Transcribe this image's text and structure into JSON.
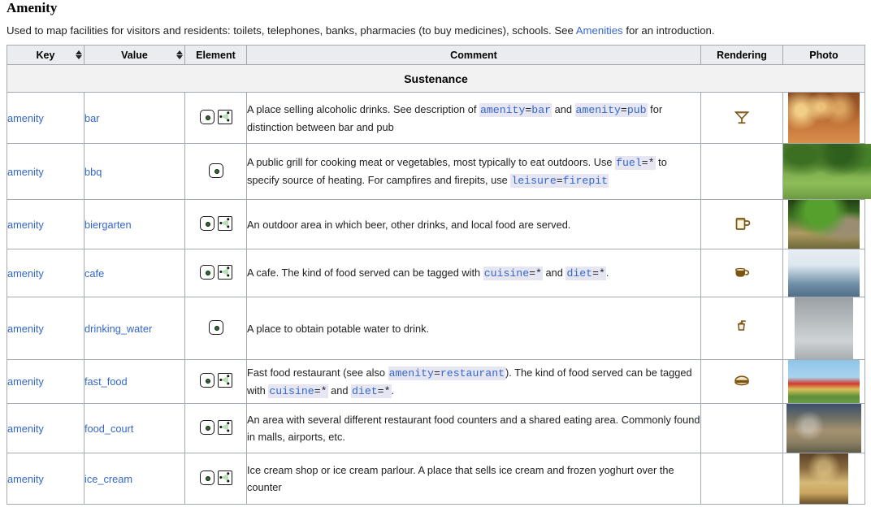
{
  "page": {
    "title": "Amenity",
    "intro_before": "Used to map facilities for visitors and residents: toilets, telephones, banks, pharmacies (to buy medicines), schools. See ",
    "intro_link": "Amenities",
    "intro_after": " for an introduction."
  },
  "table": {
    "headers": {
      "key": "Key",
      "value": "Value",
      "element": "Element",
      "comment": "Comment",
      "rendering": "Rendering",
      "photo": "Photo"
    },
    "group_heading": "Sustenance",
    "rows": [
      {
        "key": "amenity",
        "value": "bar",
        "elements": [
          "node",
          "area"
        ],
        "comment_html": "A place selling alcoholic drinks. See description of <code class=\"tag\"><span class=\"k\">amenity</span><span class=\"eq\">=</span><span class=\"v\">bar</span></code> and <code class=\"tag\"><span class=\"k\">amenity</span><span class=\"eq\">=</span><span class=\"v\">pub</span></code> for distinction between bar and pub",
        "rendering": "cocktail-glass-icon",
        "photo": "bar-interior-photo"
      },
      {
        "key": "amenity",
        "value": "bbq",
        "elements": [
          "node"
        ],
        "comment_html": "A public grill for cooking meat or vegetables, most typically to eat outdoors. Use <code class=\"tag\"><span class=\"k\">fuel</span><span class=\"eq\">=*</span></code> to specify source of heating. For campfires and firepits, use <code class=\"tag\"><span class=\"k\">leisure</span><span class=\"eq\">=</span><span class=\"v\">firepit</span></code>",
        "rendering": "",
        "photo": "park-bbq-grills-photo"
      },
      {
        "key": "amenity",
        "value": "biergarten",
        "elements": [
          "node",
          "area"
        ],
        "comment_html": "An outdoor area in which beer, other drinks, and local food are served.",
        "rendering": "beer-mug-icon",
        "photo": "biergarten-trees-photo"
      },
      {
        "key": "amenity",
        "value": "cafe",
        "elements": [
          "node",
          "area"
        ],
        "comment_html": "A cafe. The kind of food served can be tagged with <code class=\"tag\"><span class=\"k\">cuisine</span><span class=\"eq\">=*</span></code> and <code class=\"tag\"><span class=\"k\">diet</span><span class=\"eq\">=*</span></code>.",
        "rendering": "coffee-cup-icon",
        "photo": "cafe-terrace-photo"
      },
      {
        "key": "amenity",
        "value": "drinking_water",
        "elements": [
          "node"
        ],
        "comment_html": "A place to obtain potable water to drink.",
        "rendering": "drinking-fountain-icon",
        "photo": "drinking-fountain-photo"
      },
      {
        "key": "amenity",
        "value": "fast_food",
        "elements": [
          "node",
          "area"
        ],
        "comment_html": "Fast food restaurant (see also <code class=\"tag\"><span class=\"k\">amenity</span><span class=\"eq\">=</span><span class=\"v\">restaurant</span></code>). The kind of food served can be tagged with <code class=\"tag\"><span class=\"k\">cuisine</span><span class=\"eq\">=*</span></code> and <code class=\"tag\"><span class=\"k\">diet</span><span class=\"eq\">=*</span></code>.",
        "rendering": "burger-icon",
        "photo": "fast-food-restaurant-photo"
      },
      {
        "key": "amenity",
        "value": "food_court",
        "elements": [
          "node",
          "area"
        ],
        "comment_html": "An area with several different restaurant food counters and a shared eating area. Commonly found in malls, airports, etc.",
        "rendering": "",
        "photo": "food-court-mall-photo"
      },
      {
        "key": "amenity",
        "value": "ice_cream",
        "elements": [
          "node",
          "area"
        ],
        "comment_html": "Ice cream shop or ice cream parlour. A place that sells ice cream and frozen yoghurt over the counter",
        "rendering": "",
        "photo": "ice-cream-counter-photo"
      }
    ]
  },
  "colors": {
    "link": "#3366cc",
    "header_bg": "#eaecf0",
    "group_bg": "#f2f2f2",
    "border": "#a2a9b1",
    "code_bg": "#e6e6f2",
    "icon_brown": "#7a5410",
    "area_green": "#b8e0b8"
  }
}
